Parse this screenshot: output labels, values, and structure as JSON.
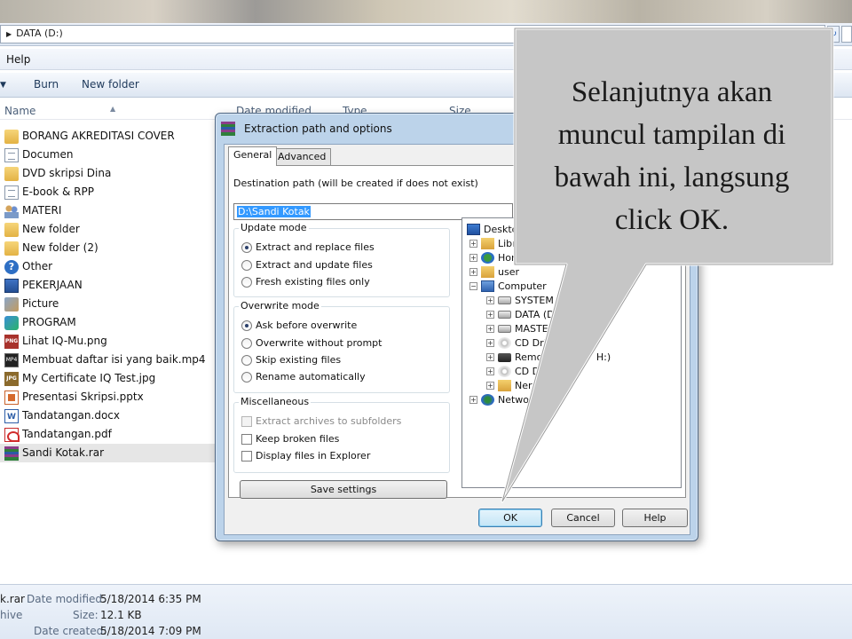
{
  "explorer": {
    "address": "DATA (D:)",
    "menu": {
      "help": "Help"
    },
    "toolbar": {
      "burn": "Burn",
      "new_folder": "New folder"
    },
    "columns": {
      "name": "Name",
      "date": "Date modified",
      "type": "Type",
      "size": "Size"
    },
    "files": [
      {
        "name": "BORANG AKREDITASI COVER",
        "icon": "folder-icon"
      },
      {
        "name": "Documen",
        "icon": "document-icon"
      },
      {
        "name": "DVD skripsi Dina",
        "icon": "folder-icon"
      },
      {
        "name": "E-book & RPP",
        "icon": "document-icon"
      },
      {
        "name": "MATERI",
        "icon": "users-icon"
      },
      {
        "name": "New folder",
        "icon": "folder-icon"
      },
      {
        "name": "New folder (2)",
        "icon": "folder-icon"
      },
      {
        "name": "Other",
        "icon": "help-icon"
      },
      {
        "name": "PEKERJAAN",
        "icon": "computer-icon"
      },
      {
        "name": "Picture",
        "icon": "picture-icon"
      },
      {
        "name": "PROGRAM",
        "icon": "program-icon"
      },
      {
        "name": "Lihat IQ-Mu.png",
        "icon": "png-icon"
      },
      {
        "name": "Membuat daftar isi yang baik.mp4",
        "icon": "mp4-icon"
      },
      {
        "name": "My Certificate IQ Test.jpg",
        "icon": "jpg-icon"
      },
      {
        "name": "Presentasi Skripsi.pptx",
        "icon": "pptx-icon"
      },
      {
        "name": "Tandatangan.docx",
        "icon": "docx-icon"
      },
      {
        "name": "Tandatangan.pdf",
        "icon": "pdf-icon"
      },
      {
        "name": "Sandi Kotak.rar",
        "icon": "rar-icon",
        "selected": true
      }
    ],
    "details": {
      "name_fragment": "k.rar",
      "type_fragment": "hive",
      "date_modified_label": "Date modified:",
      "date_modified": "5/18/2014 6:35 PM",
      "size_label": "Size:",
      "size": "12.1 KB",
      "date_created_label": "Date created:",
      "date_created": "5/18/2014 7:09 PM"
    }
  },
  "dialog": {
    "title": "Extraction path and options",
    "tabs": [
      "General",
      "Advanced"
    ],
    "destination_label": "Destination path (will be created if does not exist)",
    "destination_value": "D:\\Sandi Kotak",
    "update_mode": {
      "title": "Update mode",
      "options": [
        "Extract and replace files",
        "Extract and update files",
        "Fresh existing files only"
      ],
      "selected": 0
    },
    "overwrite_mode": {
      "title": "Overwrite mode",
      "options": [
        "Ask before overwrite",
        "Overwrite without prompt",
        "Skip existing files",
        "Rename automatically"
      ],
      "selected": 0
    },
    "misc": {
      "title": "Miscellaneous",
      "options": [
        "Extract archives to subfolders",
        "Keep broken files",
        "Display files in Explorer"
      ]
    },
    "save_settings": "Save settings",
    "tree": [
      {
        "label": "Desktop"
      },
      {
        "label": "Libr"
      },
      {
        "label": "Hon"
      },
      {
        "label": "user"
      },
      {
        "label": "Computer"
      },
      {
        "label": "SYSTEM ("
      },
      {
        "label": "DATA (D"
      },
      {
        "label": "MASTER"
      },
      {
        "label": "CD Drive"
      },
      {
        "label": "Remov",
        "suffix": "H:)"
      },
      {
        "label": "CD D"
      },
      {
        "label": "Nero"
      },
      {
        "label": "Network"
      }
    ],
    "buttons": {
      "ok": "OK",
      "cancel": "Cancel",
      "help": "Help"
    }
  },
  "callout": {
    "line1": "Selanjutnya  akan",
    "line2": "muncul tampilan  di",
    "line3": "bawah ini, langsung",
    "line4": "click  OK."
  }
}
